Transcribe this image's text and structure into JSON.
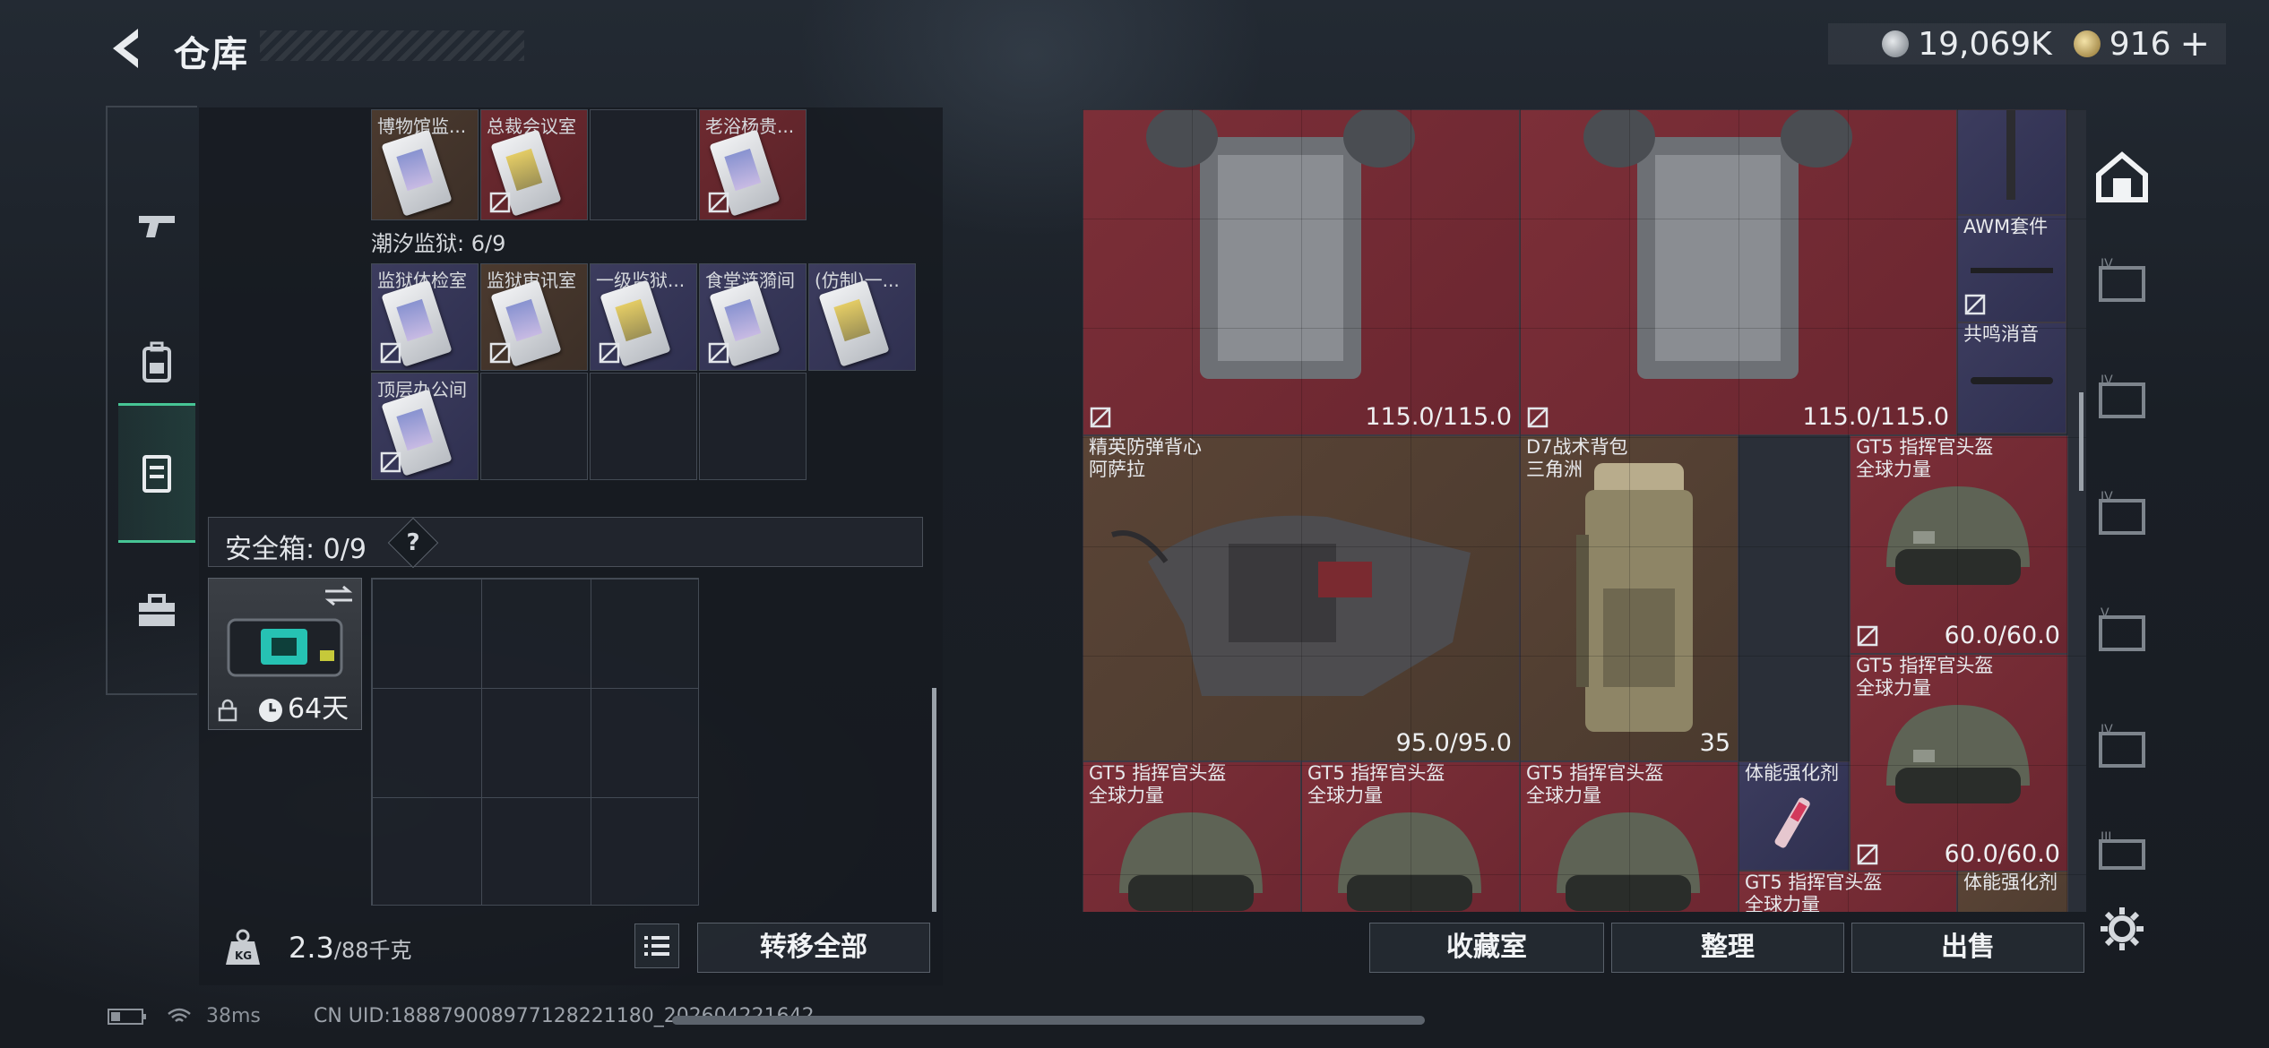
{
  "header": {
    "title": "仓库",
    "currency_silver": "19,069K",
    "currency_gold": "916"
  },
  "sidebar_left": {
    "items": [
      "gun-icon",
      "backpack-icon",
      "vest-icon",
      "toolbox-icon"
    ],
    "active": 2
  },
  "left_panel": {
    "top_row": [
      {
        "label": "博物馆监..."
      },
      {
        "label": "总裁会议室"
      },
      {
        "label": ""
      },
      {
        "label": "老浴杨贵..."
      }
    ],
    "section_title": "潮汐监狱: 6/9",
    "prison_row1": [
      {
        "label": "监狱体检室"
      },
      {
        "label": "监狱审讯室"
      },
      {
        "label": "一级监狱..."
      },
      {
        "label": "食堂涟漪间"
      },
      {
        "label": "(仿制)一..."
      }
    ],
    "prison_row2": [
      {
        "label": "顶层办公间"
      }
    ],
    "safe_label": "安全箱: 0/9",
    "safe_help": "?",
    "safe_days": "64天",
    "weight_current": "2.3",
    "weight_max": "/88千克",
    "transfer_all": "转移全部"
  },
  "right_panel": {
    "items": [
      {
        "name": "",
        "durability": "115.0/115.0"
      },
      {
        "name": "",
        "durability": "115.0/115.0"
      },
      {
        "name": "AWM套件",
        "durability": ""
      },
      {
        "name": "共鸣消音",
        "durability": ""
      },
      {
        "name": "精英防弹背心\n阿萨拉",
        "durability": "95.0/95.0"
      },
      {
        "name": "D7战术背包\n三角洲",
        "durability": "35"
      },
      {
        "name": "GT5 指挥官头盔\n全球力量",
        "durability": "60.0/60.0"
      },
      {
        "name": "GT5 指挥官头盔\n全球力量",
        "durability": "60.0/60.0"
      },
      {
        "name": "GT5 指挥官头盔\n全球力量",
        "durability": ""
      },
      {
        "name": "GT5 指挥官头盔\n全球力量",
        "durability": ""
      },
      {
        "name": "GT5 指挥官头盔\n全球力量",
        "durability": ""
      },
      {
        "name": "体能强化剂",
        "durability": ""
      },
      {
        "name": "GT5 指挥官头盔\n全球力量",
        "durability": ""
      },
      {
        "name": "体能强化剂",
        "durability": ""
      }
    ],
    "buttons": [
      "收藏室",
      "整理",
      "出售"
    ]
  },
  "status_bar": {
    "ping": "38ms",
    "uid": "CN UID:188879008977128221180_202604221642"
  },
  "colors": {
    "accent": "#47c595",
    "red_rarity": "#7c2f38",
    "brown_rarity": "#5a4436",
    "purple_rarity": "#3c3c5e"
  }
}
